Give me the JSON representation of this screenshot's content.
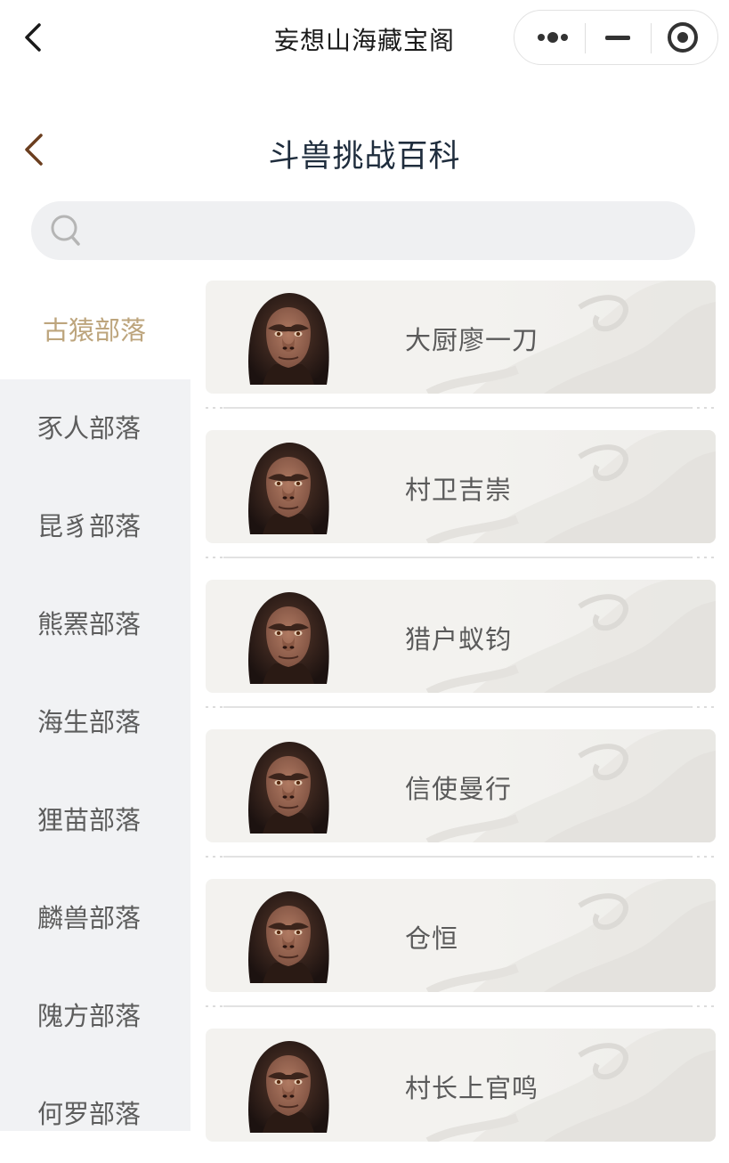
{
  "topbar": {
    "title": "妄想山海藏宝阁"
  },
  "header": {
    "title": "斗兽挑战百科"
  },
  "search": {
    "value": "",
    "placeholder": ""
  },
  "sidebar": {
    "items": [
      {
        "label": "古猿部落",
        "active": true
      },
      {
        "label": "豕人部落"
      },
      {
        "label": "昆豸部落"
      },
      {
        "label": "熊罴部落"
      },
      {
        "label": "海生部落"
      },
      {
        "label": "狸苗部落"
      },
      {
        "label": "麟兽部落"
      },
      {
        "label": "隗方部落"
      },
      {
        "label": "何罗部落"
      }
    ]
  },
  "list": {
    "items": [
      {
        "name": "大厨廖一刀",
        "avatar": "ape-portrait"
      },
      {
        "name": "村卫吉崇",
        "avatar": "ape-portrait"
      },
      {
        "name": "猎户蚁钧",
        "avatar": "ape-portrait"
      },
      {
        "name": "信使曼行",
        "avatar": "ape-portrait"
      },
      {
        "name": "仓恒",
        "avatar": "ape-portrait"
      },
      {
        "name": "村长上官鸣",
        "avatar": "ape-portrait"
      }
    ]
  },
  "colors": {
    "accent": "#bda57d",
    "sidebar_bg": "#f1f2f4",
    "card_bg": "#f3f2ef",
    "title": "#1f2d3d"
  }
}
